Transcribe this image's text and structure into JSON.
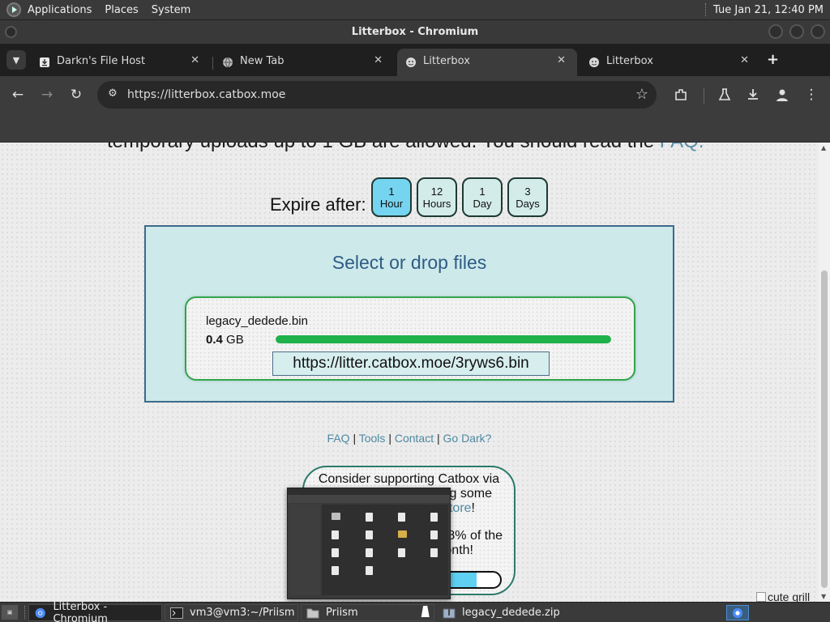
{
  "top_panel": {
    "menus": [
      "Applications",
      "Places",
      "System"
    ],
    "clock": "Tue Jan 21, 12:40 PM"
  },
  "window": {
    "title": "Litterbox - Chromium"
  },
  "tabs": [
    {
      "title": "Darkn's File Host",
      "icon": "download-icon",
      "active": false
    },
    {
      "title": "New Tab",
      "icon": "globe-icon",
      "active": false
    },
    {
      "title": "Litterbox",
      "icon": "litterbox-favicon",
      "active": true
    },
    {
      "title": "Litterbox",
      "icon": "litterbox-favicon",
      "active": false
    }
  ],
  "toolbar": {
    "url": "https://litterbox.catbox.moe",
    "icons": [
      "back-icon",
      "forward-icon",
      "reload-icon",
      "site-info-icon",
      "bookmark-star-icon",
      "extensions-icon",
      "labs-flask-icon",
      "download-icon",
      "profile-icon",
      "menu-kebab-icon"
    ]
  },
  "page": {
    "cutoff_text": "temporary uploads up to 1 GB are allowed. You should read the",
    "cutoff_link": "FAQ.",
    "expire_label": "Expire after:",
    "expire_options": [
      {
        "num": "1",
        "unit": "Hour",
        "selected": true
      },
      {
        "num": "12",
        "unit": "Hours",
        "selected": false
      },
      {
        "num": "1",
        "unit": "Day",
        "selected": false
      },
      {
        "num": "3",
        "unit": "Days",
        "selected": false
      }
    ],
    "drop_title": "Select or drop files",
    "upload": {
      "file_name": "legacy_dedede.bin",
      "size_value": "0.4",
      "size_unit": "GB",
      "progress_percent": 100,
      "result_url": "https://litter.catbox.moe/3ryws6.bin"
    },
    "footer_links": [
      "FAQ",
      "Tools",
      "Contact",
      "Go Dark?"
    ],
    "footer_separator": "|",
    "support": {
      "line1": "Consider supporting Catbox via",
      "line2": "g some",
      "line3_link": "tore",
      "line3_suffix": "!",
      "line4": "8% of the",
      "line5": "onth!",
      "funding_fill_percent": 58
    },
    "broken_image_alt": "cute grill"
  },
  "taskbar": {
    "tasks": [
      {
        "label": "Litterbox - Chromium",
        "icon": "chromium-icon",
        "active": true
      },
      {
        "label": "vm3@vm3:~/Priism",
        "icon": "terminal-icon",
        "active": false
      },
      {
        "label": "Priism",
        "icon": "folder-icon",
        "active": false
      },
      {
        "label": "legacy_dedede.zip",
        "icon": "archive-icon",
        "active": false
      }
    ]
  },
  "colors": {
    "selected_expire": "#75d4f0",
    "drop_zone_bg": "#cde9ea",
    "progress_green": "#1fb14a",
    "link_blue": "#4e8aa3"
  }
}
